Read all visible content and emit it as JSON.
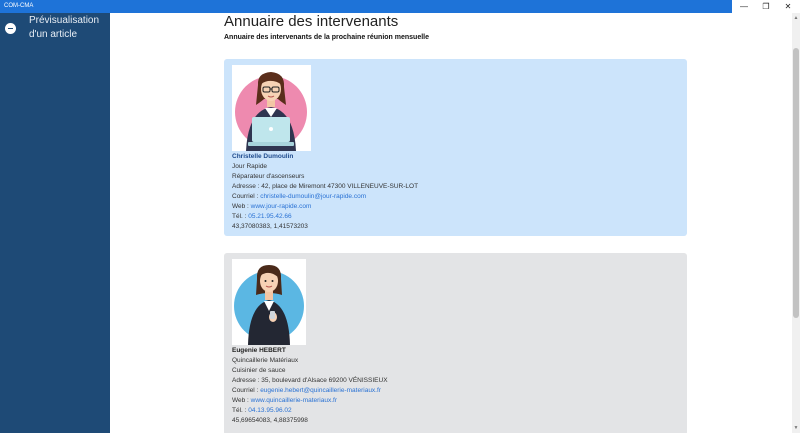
{
  "window": {
    "title": "COM-CMA",
    "minimize_glyph": "—",
    "restore_glyph": "❐",
    "close_glyph": "✕"
  },
  "sidebar": {
    "back_icon": "back-arrow-icon",
    "heading": "Prévisualisation d'un article"
  },
  "main": {
    "title": "Annuaire des intervenants",
    "subtitle": "Annuaire des intervenants de la prochaine réunion mensuelle"
  },
  "contacts": [
    {
      "name": "Christelle Dumoulin",
      "company": "Jour Rapide",
      "role": "Réparateur d'ascenseurs",
      "address_label": "Adresse : ",
      "address": "42, place de Miremont 47300 VILLENEUVE-SUR-LOT",
      "email_label": "Courriel : ",
      "email": "christelle-dumoulin@jour-rapide.com",
      "web_label": "Web : ",
      "web": "www.jour-rapide.com",
      "phone_label": "Tél. : ",
      "phone": "05.21.95.42.66",
      "coords": "43,37080383, 1,41573203",
      "colors": {
        "card": "#cce4fb",
        "avatar_circle": "#ee8aaf"
      }
    },
    {
      "name": "Eugenie HEBERT",
      "company": "Quincaillerie Matériaux",
      "role": "Cuisinier de sauce",
      "address_label": "Adresse : ",
      "address": "35, boulevard d'Alsace 69200 VÉNISSIEUX",
      "email_label": "Courriel : ",
      "email": "eugenie.hebert@quincaillerie-materiaux.fr",
      "web_label": "Web : ",
      "web": "www.quincaillerie-materiaux.fr",
      "phone_label": "Tél. : ",
      "phone": "04.13.95.96.02",
      "coords": "45,69654083, 4,88375998",
      "colors": {
        "card": "#e3e4e6",
        "avatar_circle": "#5bb7e3"
      }
    }
  ],
  "theme": {
    "titlebar": "#1e73d8",
    "sidebar": "#1e4a76",
    "link": "#2a72d4"
  }
}
